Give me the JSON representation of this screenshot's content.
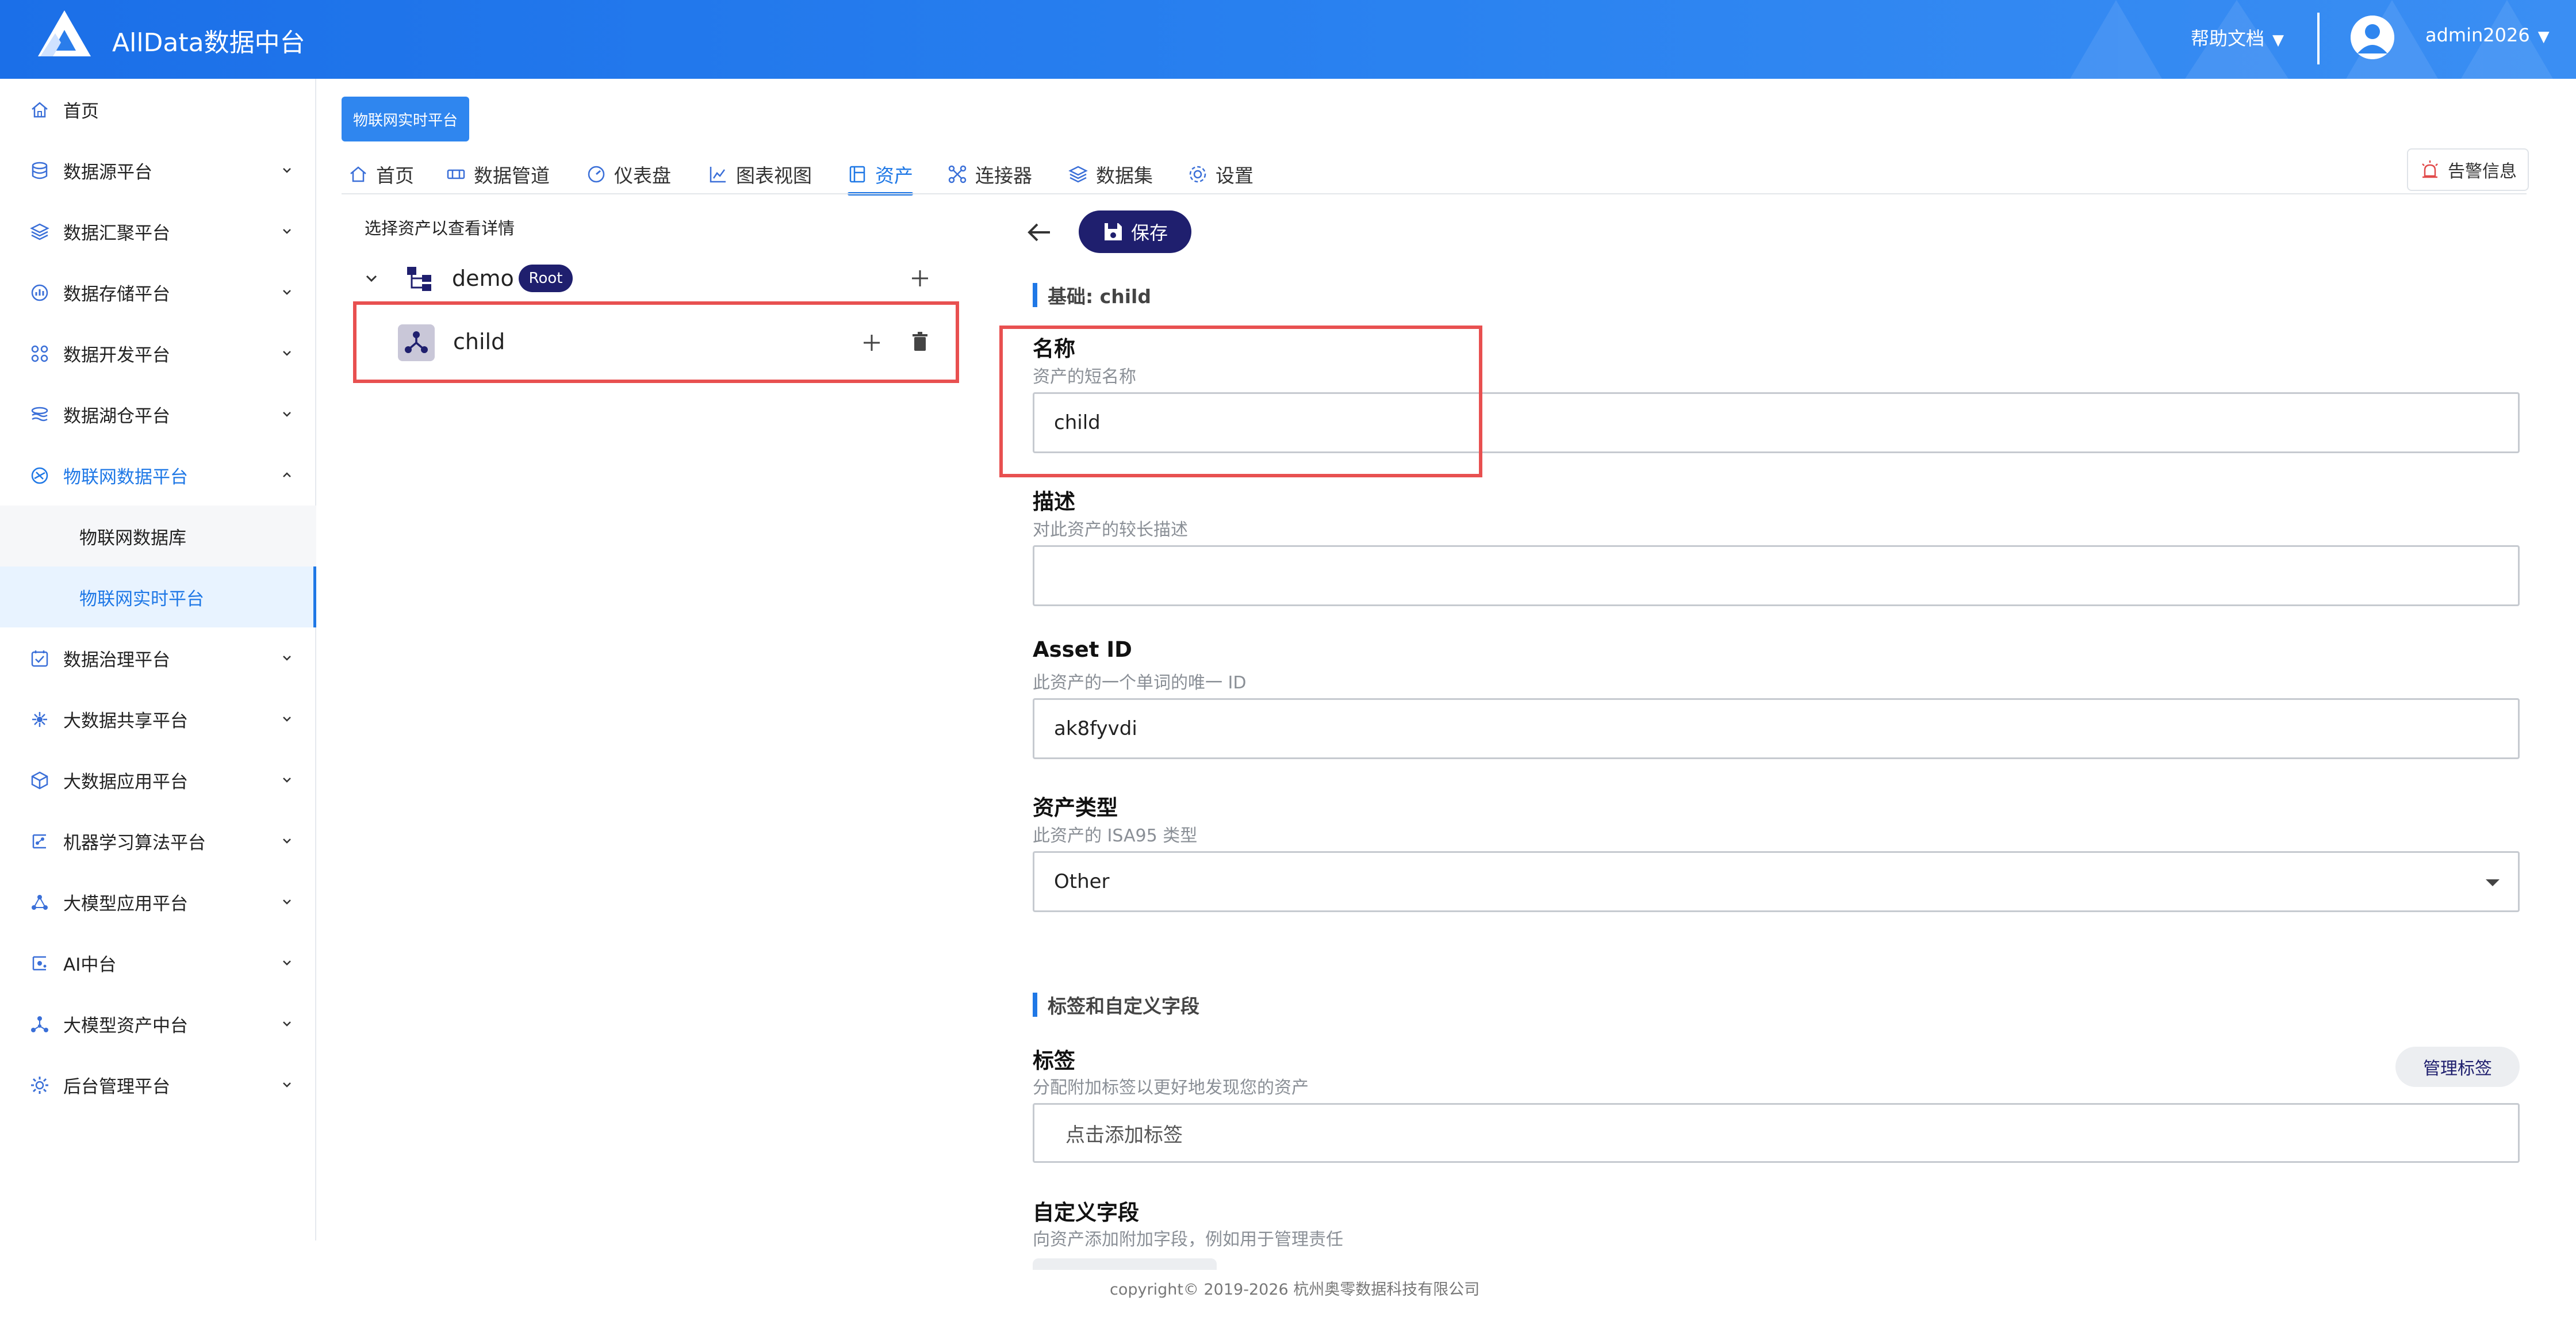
{
  "header": {
    "brand": "AllData数据中台",
    "help": "帮助文档",
    "user": "admin2026",
    "caret": "▼"
  },
  "sidebar": {
    "items": [
      {
        "label": "首页",
        "icon": "home-icon"
      },
      {
        "label": "数据源平台",
        "icon": "database-icon"
      },
      {
        "label": "数据汇聚平台",
        "icon": "layers-icon"
      },
      {
        "label": "数据存储平台",
        "icon": "storage-chart-icon"
      },
      {
        "label": "数据开发平台",
        "icon": "grid-nodes-icon"
      },
      {
        "label": "数据湖仓平台",
        "icon": "lake-icon"
      },
      {
        "label": "物联网数据平台",
        "icon": "iot-icon"
      },
      {
        "label": "数据治理平台",
        "icon": "governance-icon"
      },
      {
        "label": "大数据共享平台",
        "icon": "share-hub-icon"
      },
      {
        "label": "大数据应用平台",
        "icon": "cube-icon"
      },
      {
        "label": "机器学习算法平台",
        "icon": "ml-icon"
      },
      {
        "label": "大模型应用平台",
        "icon": "llm-app-icon"
      },
      {
        "label": "AI中台",
        "icon": "ai-icon"
      },
      {
        "label": "大模型资产中台",
        "icon": "llm-asset-icon"
      },
      {
        "label": "后台管理平台",
        "icon": "admin-gear-icon"
      }
    ],
    "subitems": [
      {
        "label": "物联网数据库"
      },
      {
        "label": "物联网实时平台"
      }
    ]
  },
  "page_tag": "物联网实时平台",
  "tabs": [
    {
      "label": "首页",
      "icon": "home-icon"
    },
    {
      "label": "数据管道",
      "icon": "pipeline-icon"
    },
    {
      "label": "仪表盘",
      "icon": "gauge-icon"
    },
    {
      "label": "图表视图",
      "icon": "chart-icon"
    },
    {
      "label": "资产",
      "icon": "asset-icon"
    },
    {
      "label": "连接器",
      "icon": "connector-icon"
    },
    {
      "label": "数据集",
      "icon": "dataset-icon"
    },
    {
      "label": "设置",
      "icon": "settings-icon"
    }
  ],
  "alarm": "告警信息",
  "tree": {
    "title": "选择资产以查看详情",
    "root_name": "demo",
    "root_badge": "Root",
    "child_name": "child"
  },
  "form": {
    "save": "保存",
    "section_basic": "基础: child",
    "name_label": "名称",
    "name_help": "资产的短名称",
    "name_value": "child",
    "desc_label": "描述",
    "desc_help": "对此资产的较长描述",
    "desc_value": "",
    "id_label": "Asset ID",
    "id_help": "此资产的一个单词的唯一 ID",
    "id_value": "ak8fyvdi",
    "type_label": "资产类型",
    "type_help": "此资产的 ISA95 类型",
    "type_value": "Other",
    "section_tags": "标签和自定义字段",
    "tags_label": "标签",
    "tags_help": "分配附加标签以更好地发现您的资产",
    "tags_placeholder": "点击添加标签",
    "manage_tags": "管理标签",
    "custom_label": "自定义字段",
    "custom_help": "向资产添加附加字段，例如用于管理责任"
  },
  "footer": "copyright© 2019-2026 杭州奥零数据科技有限公司",
  "colors": {
    "primary": "#1f78e6",
    "navy": "#1f1f6e",
    "highlight": "#e85050"
  }
}
